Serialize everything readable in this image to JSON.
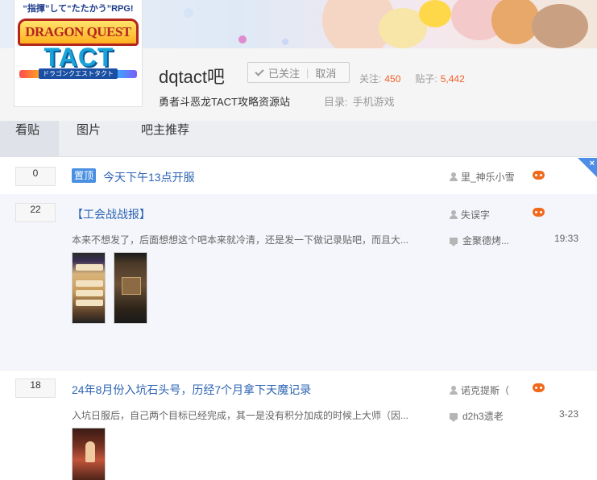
{
  "header": {
    "logo": {
      "tagline": "“指揮”して“たたかう”RPG!",
      "title_main": "DRAGON QUEST",
      "title_sub": "TACT",
      "subtitle": "ドラゴンクエストタクト"
    },
    "forum_name": "dqtact吧",
    "follow_button": {
      "followed_label": "已关注",
      "cancel_label": "取消"
    },
    "stats": {
      "follow_label": "关注:",
      "follow_count": "450",
      "posts_label": "贴子:",
      "posts_count": "5,442"
    },
    "slogan": "勇者斗恶龙TACT攻略资源站",
    "category_label": "目录:",
    "category_value": "手机游戏"
  },
  "tabs": [
    {
      "label": "看贴",
      "active": true
    },
    {
      "label": "图片",
      "active": false
    },
    {
      "label": "吧主推荐",
      "active": false
    }
  ],
  "threads": [
    {
      "reply_count": "0",
      "badge": "置顶",
      "title": "今天下午13点开服",
      "author": "里_神乐小雪"
    },
    {
      "reply_count": "22",
      "title": "【工会战战报】",
      "excerpt": "本来不想发了，后面想想这个吧本来就冷清，还是发一下做记录贴吧，而且大...",
      "author": "失误字",
      "last_reply_user": "金聚德烤...",
      "last_reply_time": "19:33"
    },
    {
      "reply_count": "18",
      "title": "24年8月份入坑石头号，历经7个月拿下天魔记录",
      "excerpt": "入坑日服后，自己两个目标已经完成，其一是没有积分加成的时候上大师（因...",
      "author": "诺克提斯（",
      "last_reply_user": "d2h3遗老",
      "last_reply_time": "3-23"
    }
  ],
  "close_symbol": "×",
  "colors": {
    "accent": "#2d64b3",
    "stat_number": "#f35f2b",
    "badge": "#4a90e2"
  }
}
